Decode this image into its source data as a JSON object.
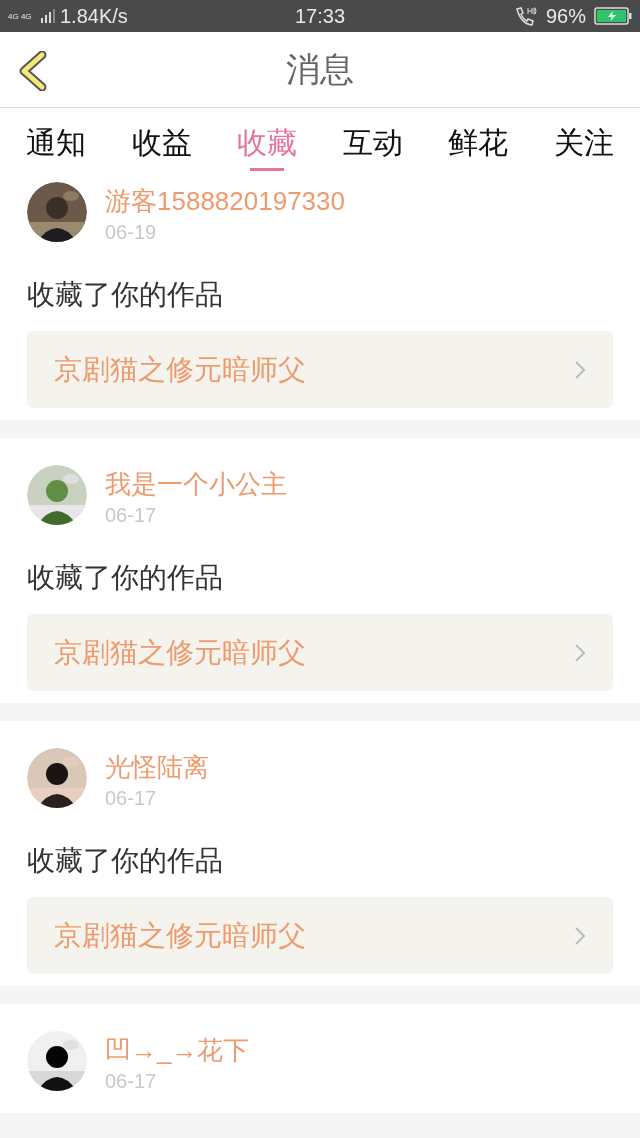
{
  "status_bar": {
    "network": "4G 4G",
    "speed": "1.84K/s",
    "time": "17:33",
    "battery": "96%"
  },
  "header": {
    "title": "消息"
  },
  "tabs": [
    {
      "label": "通知",
      "selected": false
    },
    {
      "label": "收益",
      "selected": false
    },
    {
      "label": "收藏",
      "selected": true
    },
    {
      "label": "互动",
      "selected": false
    },
    {
      "label": "鲜花",
      "selected": false
    },
    {
      "label": "关注",
      "selected": false
    }
  ],
  "messages": [
    {
      "user": "游客1588820197330",
      "date": "06-19",
      "action": "收藏了你的作品",
      "work": "京剧猫之修元暗师父"
    },
    {
      "user": "我是一个小公主",
      "date": "06-17",
      "action": "收藏了你的作品",
      "work": "京剧猫之修元暗师父"
    },
    {
      "user": "光怪陆离",
      "date": "06-17",
      "action": "收藏了你的作品",
      "work": "京剧猫之修元暗师父"
    },
    {
      "user": "凹→_→花下",
      "date": "06-17"
    }
  ]
}
